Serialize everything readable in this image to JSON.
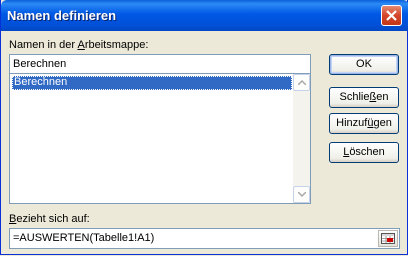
{
  "dialog": {
    "title": "Namen definieren",
    "names_label_pre": "Namen in der ",
    "names_label_accel": "A",
    "names_label_post": "rbeitsmappe:",
    "name_input_value": "Berechnen",
    "names_list": [
      "Berechnen"
    ],
    "refers_label_pre": "",
    "refers_label_accel": "B",
    "refers_label_post": "ezieht sich auf:",
    "refers_value": "=AUSWERTEN(Tabelle1!A1)"
  },
  "buttons": {
    "ok": "OK",
    "close_pre": "Schlie",
    "close_accel": "ß",
    "close_post": "en",
    "add_pre": "Hinzuf",
    "add_accel": "ü",
    "add_post": "gen",
    "delete_pre": "",
    "delete_accel": "L",
    "delete_post": "öschen"
  },
  "icons": {
    "close": "close-icon",
    "scroll_up": "arrow-up-icon",
    "scroll_down": "arrow-down-icon",
    "range_select": "range-select-icon"
  },
  "colors": {
    "titlebar": "#0058e5",
    "selection": "#316ac5",
    "close_button": "#d4462b"
  }
}
